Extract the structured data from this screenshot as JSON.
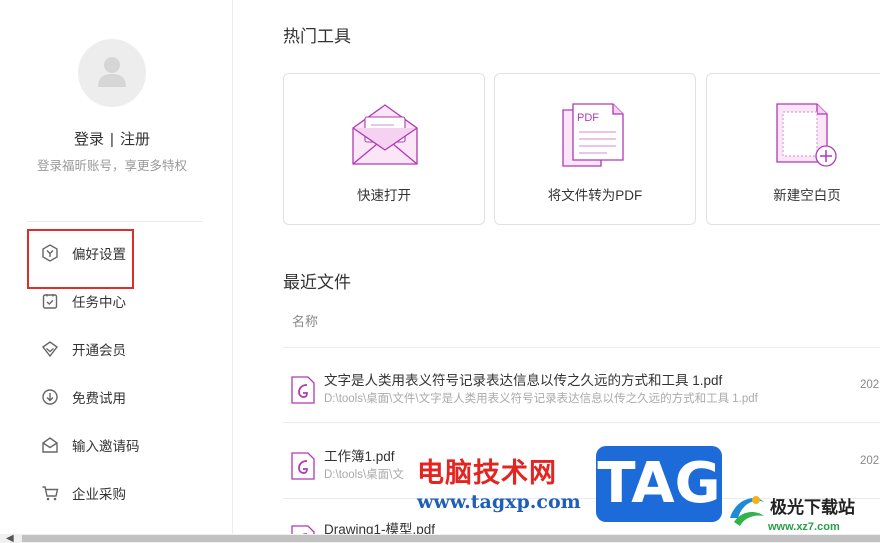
{
  "sidebar": {
    "login": "登录",
    "separator": "|",
    "register": "注册",
    "login_tip": "登录福昕账号，享更多特权",
    "items": [
      {
        "label": "偏好设置",
        "icon": "preferences-icon"
      },
      {
        "label": "任务中心",
        "icon": "task-center-icon"
      },
      {
        "label": "开通会员",
        "icon": "membership-icon"
      },
      {
        "label": "免费试用",
        "icon": "free-trial-icon"
      },
      {
        "label": "输入邀请码",
        "icon": "invite-code-icon"
      },
      {
        "label": "企业采购",
        "icon": "enterprise-purchase-icon"
      }
    ]
  },
  "main": {
    "hot_tools_title": "热门工具",
    "tools": [
      {
        "label": "快速打开",
        "icon": "quick-open-icon"
      },
      {
        "label": "将文件转为PDF",
        "icon": "convert-to-pdf-icon"
      },
      {
        "label": "新建空白页",
        "icon": "new-blank-page-icon"
      }
    ],
    "recent_title": "最近文件",
    "column_name": "名称",
    "files": [
      {
        "name": "文字是人类用表义符号记录表达信息以传之久远的方式和工具 1.pdf",
        "path": "D:\\tools\\桌面\\文件\\文字是人类用表义符号记录表达信息以传之久远的方式和工具 1.pdf",
        "date": "202"
      },
      {
        "name": "工作簿1.pdf",
        "path": "D:\\tools\\桌面\\文",
        "date": "202"
      },
      {
        "name": "Drawing1-模型.pdf",
        "path": "",
        "date": ""
      }
    ]
  },
  "watermark": {
    "site_name": "电脑技术网",
    "site_url": "www.tagxp.com",
    "tag": "TAG",
    "logo_name": "极光下载站",
    "logo_url": "www.xz7.com"
  },
  "colors": {
    "accent": "#b139b3",
    "highlight_border": "#d9312a",
    "watermark_red": "#e32421",
    "watermark_blue": "#1f5fb6",
    "tag_blue": "#1c6bd9"
  }
}
